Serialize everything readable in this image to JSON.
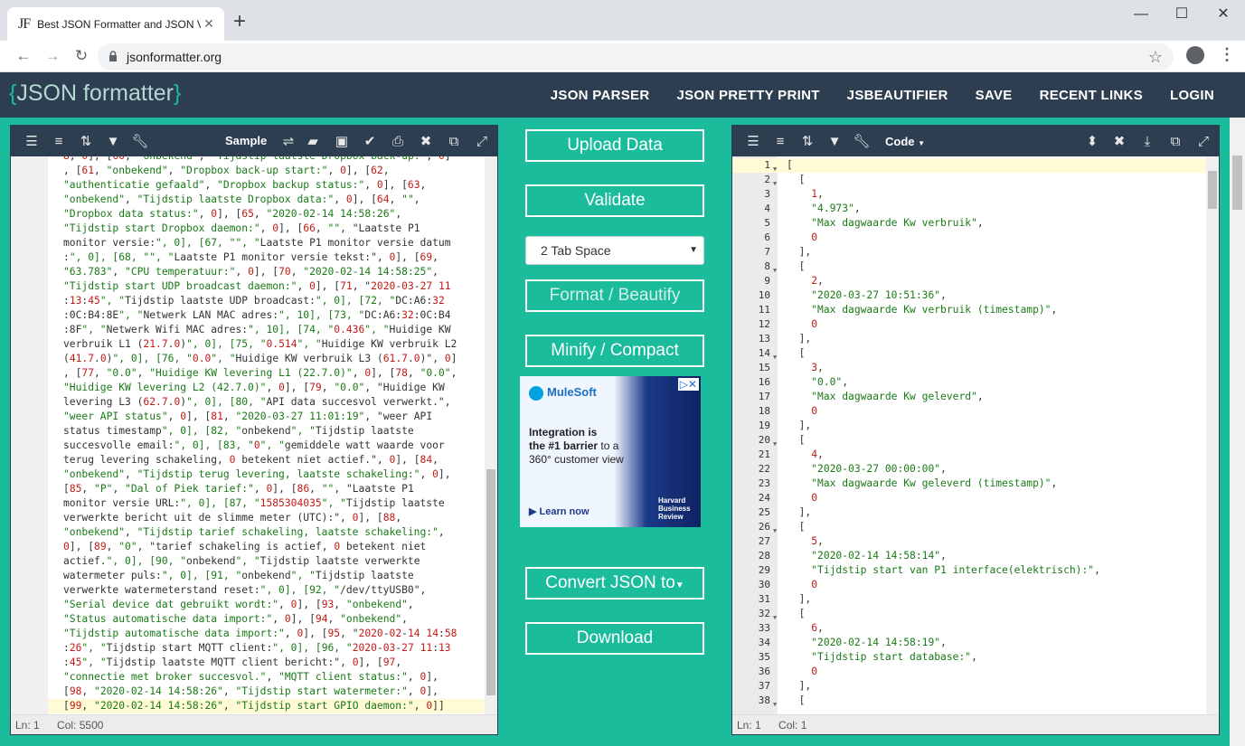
{
  "browser": {
    "tab_favicon": "JF",
    "tab_title": "Best JSON Formatter and JSON V",
    "url": "jsonformatter.org",
    "back_icon": "arrow-left",
    "forward_icon": "arrow-right",
    "reload_icon": "reload",
    "lock_icon": "lock",
    "star_icon": "star",
    "profile_icon": "account-circle",
    "menu_icon": "kebab"
  },
  "site": {
    "logo_brace_open": "{",
    "logo_text": "JSON formatter",
    "logo_brace_close": "}",
    "nav": [
      "JSON PARSER",
      "JSON PRETTY PRINT",
      "JSBEAUTIFIER",
      "SAVE",
      "RECENT LINKS",
      "LOGIN"
    ]
  },
  "left_panel": {
    "sample_label": "Sample",
    "status_ln": "Ln: 1",
    "status_col": "Col: 5500",
    "raw_lines": [
      "8, 0], [60, \"onbekend\", \"Tijdstip laatste Dropbox back-up:\", 0]",
      ", [61, \"onbekend\", \"Dropbox back-up start:\", 0], [62,",
      "\"authenticatie gefaald\", \"Dropbox backup status:\", 0], [63,",
      "\"onbekend\", \"Tijdstip laatste Dropbox data:\", 0], [64, \"\",",
      "\"Dropbox data status:\", 0], [65, \"2020-02-14 14:58:26\",",
      "\"Tijdstip start Dropbox daemon:\", 0], [66, \"\", \"Laatste P1",
      "monitor versie:\", 0], [67, \"\", \"Laatste P1 monitor versie datum",
      ":\", 0], [68, \"\", \"Laatste P1 monitor versie tekst:\", 0], [69,",
      "\"63.783\", \"CPU temperatuur:\", 0], [70, \"2020-02-14 14:58:25\",",
      "\"Tijdstip start UDP broadcast daemon:\", 0], [71, \"2020-03-27 11",
      ":13:45\", \"Tijdstip laatste UDP broadcast:\", 0], [72, \"DC:A6:32",
      ":0C:B4:8E\", \"Netwerk LAN MAC adres:\", 10], [73, \"DC:A6:32:0C:B4",
      ":8F\", \"Netwerk Wifi MAC adres:\", 10], [74, \"0.436\", \"Huidige KW",
      "verbruik L1 (21.7.0)\", 0], [75, \"0.514\", \"Huidige KW verbruik L2",
      "(41.7.0)\", 0], [76, \"0.0\", \"Huidige KW verbruik L3 (61.7.0)\", 0]",
      ", [77, \"0.0\", \"Huidige KW levering L1 (22.7.0)\", 0], [78, \"0.0\",",
      "\"Huidige KW levering L2 (42.7.0)\", 0], [79, \"0.0\", \"Huidige KW",
      "levering L3 (62.7.0)\", 0], [80, \"API data succesvol verwerkt.\",",
      "\"weer API status\", 0], [81, \"2020-03-27 11:01:19\", \"weer API",
      "status timestamp\", 0], [82, \"onbekend\", \"Tijdstip laatste",
      "succesvolle email:\", 0], [83, \"0\", \"gemiddele watt waarde voor",
      "terug levering schakeling, 0 betekent niet actief.\", 0], [84,",
      "\"onbekend\", \"Tijdstip terug levering, laatste schakeling:\", 0],",
      "[85, \"P\", \"Dal of Piek tarief:\", 0], [86, \"\", \"Laatste P1",
      "monitor versie URL:\", 0], [87, \"1585304035\", \"Tijdstip laatste",
      "verwerkte bericht uit de slimme meter (UTC):\", 0], [88,",
      "\"onbekend\", \"Tijdstip tarief schakeling, laatste schakeling:\",",
      "0], [89, \"0\", \"tarief schakeling is actief, 0 betekent niet",
      "actief.\", 0], [90, \"onbekend\", \"Tijdstip laatste verwerkte",
      "watermeter puls:\", 0], [91, \"onbekend\", \"Tijdstip laatste",
      "verwerkte watermeterstand reset:\", 0], [92, \"/dev/ttyUSB0\",",
      "\"Serial device dat gebruikt wordt:\", 0], [93, \"onbekend\",",
      "\"Status automatische data import:\", 0], [94, \"onbekend\",",
      "\"Tijdstip automatische data import:\", 0], [95, \"2020-02-14 14:58",
      ":26\", \"Tijdstip start MQTT client:\", 0], [96, \"2020-03-27 11:13",
      ":45\", \"Tijdstip laatste MQTT client bericht:\", 0], [97,",
      "\"connectie met broker succesvol.\", \"MQTT client status:\", 0],",
      "[98, \"2020-02-14 14:58:26\", \"Tijdstip start watermeter:\", 0],",
      "[99, \"2020-02-14 14:58:26\", \"Tijdstip start GPIO daemon:\", 0]]"
    ]
  },
  "middle": {
    "upload": "Upload Data",
    "validate": "Validate",
    "tab_space": "2 Tab Space",
    "format": "Format / Beautify",
    "minify": "Minify / Compact",
    "convert": "Convert JSON to",
    "download": "Download",
    "ad": {
      "brand": "MuleSoft",
      "line1": "Integration is",
      "line2": "the #1 barrier",
      "line3": "to a 360° customer view",
      "cta": "Learn now",
      "hbr1": "Harvard",
      "hbr2": "Business",
      "hbr3": "Review"
    }
  },
  "right_panel": {
    "mode_label": "Code",
    "status_ln": "Ln: 1",
    "status_col": "Col: 1",
    "lines": [
      {
        "n": "1",
        "fold": true,
        "t": "["
      },
      {
        "n": "2",
        "fold": true,
        "t": "  ["
      },
      {
        "n": "3",
        "t": "    1,",
        "k": "num"
      },
      {
        "n": "4",
        "t": "    \"4.973\",",
        "k": "str"
      },
      {
        "n": "5",
        "t": "    \"Max dagwaarde Kw verbruik\",",
        "k": "str"
      },
      {
        "n": "6",
        "t": "    0",
        "k": "num"
      },
      {
        "n": "7",
        "t": "  ],"
      },
      {
        "n": "8",
        "fold": true,
        "t": "  ["
      },
      {
        "n": "9",
        "t": "    2,",
        "k": "num"
      },
      {
        "n": "10",
        "t": "    \"2020-03-27 10:51:36\",",
        "k": "str"
      },
      {
        "n": "11",
        "t": "    \"Max dagwaarde Kw verbruik (timestamp)\",",
        "k": "str"
      },
      {
        "n": "12",
        "t": "    0",
        "k": "num"
      },
      {
        "n": "13",
        "t": "  ],"
      },
      {
        "n": "14",
        "fold": true,
        "t": "  ["
      },
      {
        "n": "15",
        "t": "    3,",
        "k": "num"
      },
      {
        "n": "16",
        "t": "    \"0.0\",",
        "k": "str"
      },
      {
        "n": "17",
        "t": "    \"Max dagwaarde Kw geleverd\",",
        "k": "str"
      },
      {
        "n": "18",
        "t": "    0",
        "k": "num"
      },
      {
        "n": "19",
        "t": "  ],"
      },
      {
        "n": "20",
        "fold": true,
        "t": "  ["
      },
      {
        "n": "21",
        "t": "    4,",
        "k": "num"
      },
      {
        "n": "22",
        "t": "    \"2020-03-27 00:00:00\",",
        "k": "str"
      },
      {
        "n": "23",
        "t": "    \"Max dagwaarde Kw geleverd (timestamp)\",",
        "k": "str"
      },
      {
        "n": "24",
        "t": "    0",
        "k": "num"
      },
      {
        "n": "25",
        "t": "  ],"
      },
      {
        "n": "26",
        "fold": true,
        "t": "  ["
      },
      {
        "n": "27",
        "t": "    5,",
        "k": "num"
      },
      {
        "n": "28",
        "t": "    \"2020-02-14 14:58:14\",",
        "k": "str"
      },
      {
        "n": "29",
        "t": "    \"Tijdstip start van P1 interface(elektrisch):\",",
        "k": "str"
      },
      {
        "n": "30",
        "t": "    0",
        "k": "num"
      },
      {
        "n": "31",
        "t": "  ],"
      },
      {
        "n": "32",
        "fold": true,
        "t": "  ["
      },
      {
        "n": "33",
        "t": "    6,",
        "k": "num"
      },
      {
        "n": "34",
        "t": "    \"2020-02-14 14:58:19\",",
        "k": "str"
      },
      {
        "n": "35",
        "t": "    \"Tijdstip start database:\",",
        "k": "str"
      },
      {
        "n": "36",
        "t": "    0",
        "k": "num"
      },
      {
        "n": "37",
        "t": "  ],"
      },
      {
        "n": "38",
        "fold": true,
        "t": "  ["
      }
    ]
  }
}
